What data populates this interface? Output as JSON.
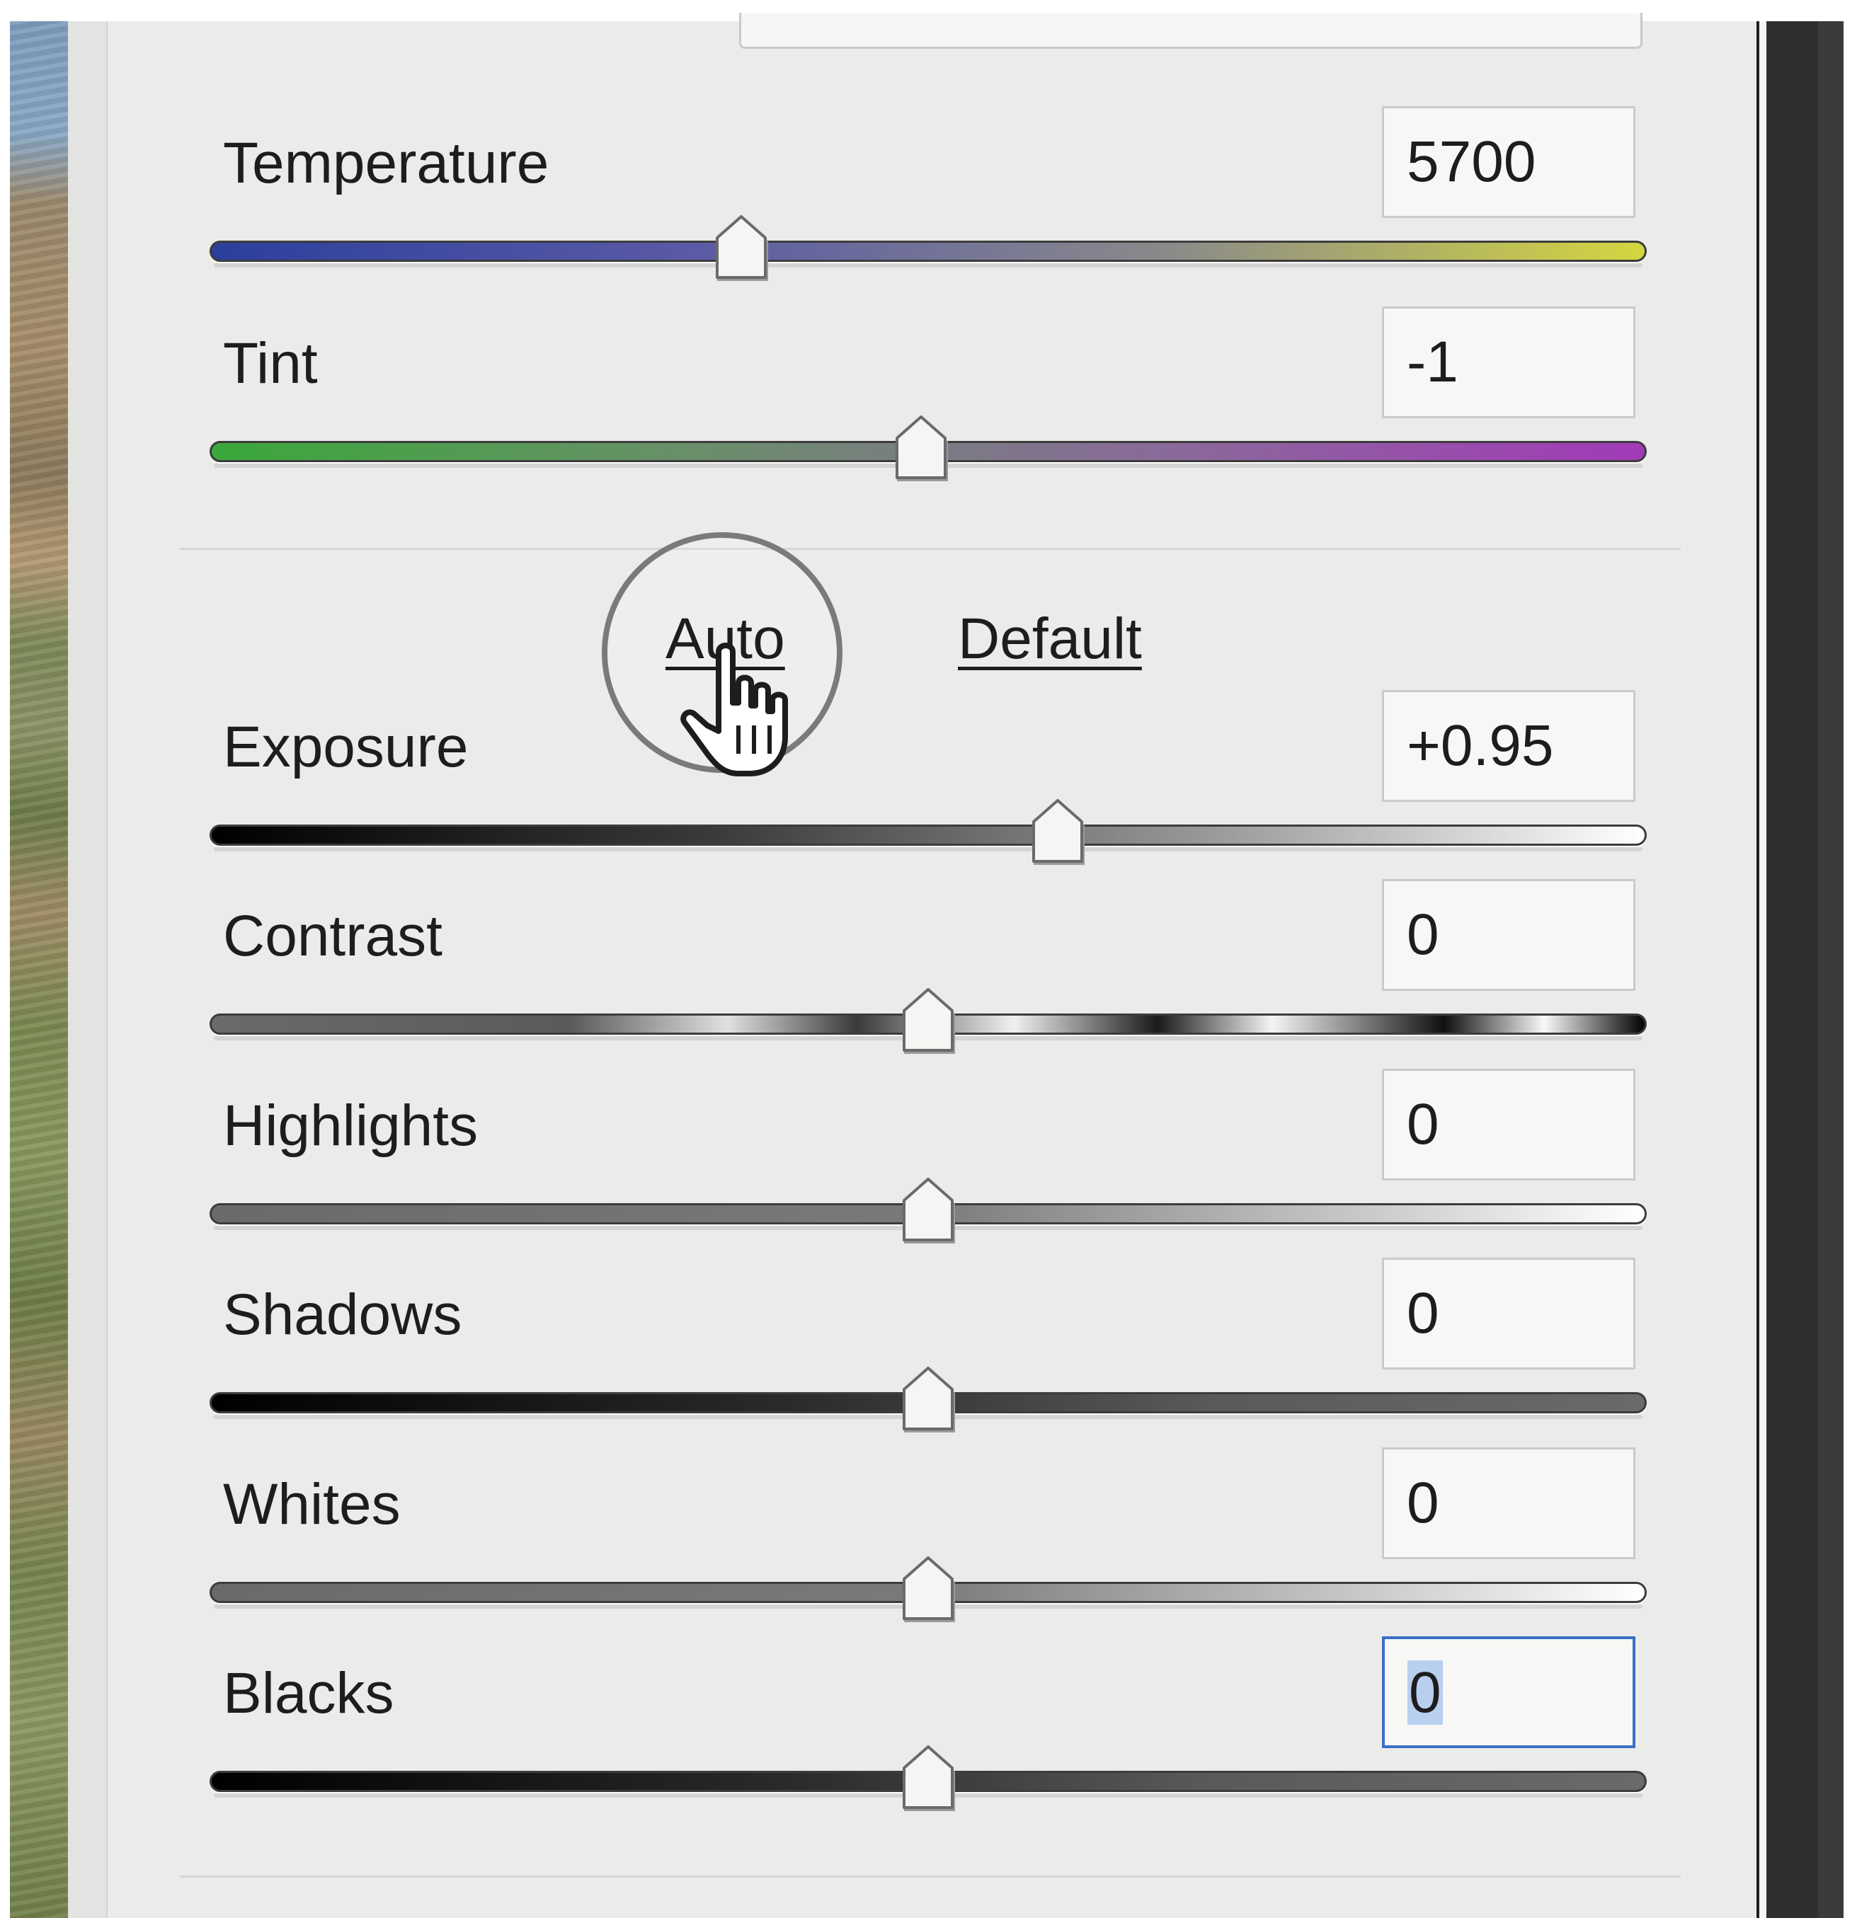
{
  "sliders": [
    {
      "label": "Temperature",
      "value": "5700",
      "position": 0.37
    },
    {
      "label": "Tint",
      "value": "-1",
      "position": 0.495
    },
    {
      "label": "Exposure",
      "value": "+0.95",
      "position": 0.59
    },
    {
      "label": "Contrast",
      "value": "0",
      "position": 0.5
    },
    {
      "label": "Highlights",
      "value": "0",
      "position": 0.5
    },
    {
      "label": "Shadows",
      "value": "0",
      "position": 0.5
    },
    {
      "label": "Whites",
      "value": "0",
      "position": 0.5
    },
    {
      "label": "Blacks",
      "value": "0",
      "position": 0.5
    }
  ],
  "buttons": {
    "auto_label": "Auto",
    "default_label": "Default"
  },
  "colors": {
    "panel_bg": "#ebebe9",
    "focus_border": "#3a6fc6",
    "temperature_track": [
      "#2c3f9c",
      "#5a5aa6",
      "#8a8a8a",
      "#d4d640"
    ],
    "tint_track": [
      "#3aa83a",
      "#6a8f6a",
      "#8a6a9a",
      "#a23ab8"
    ]
  },
  "icons": {
    "cursor": "hand-pointer-icon",
    "slider_thumb": "slider-thumb-icon"
  }
}
